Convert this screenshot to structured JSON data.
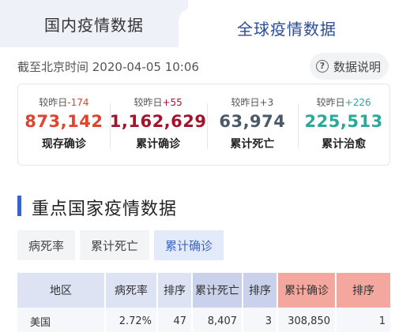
{
  "tabs": {
    "domestic": "国内疫情数据",
    "global": "全球疫情数据"
  },
  "info": {
    "timestamp": "截至北京时间 2020-04-05 10:06",
    "help_label": "数据说明",
    "help_icon": "?"
  },
  "summary": {
    "delta_prefix": "较昨日",
    "stats": [
      {
        "delta": "-174",
        "value": "873,142",
        "label": "现存确诊",
        "color": "#e0442d"
      },
      {
        "delta": "+55",
        "value": "1,162,629",
        "label": "累计确诊",
        "color": "#a3142a"
      },
      {
        "delta": "+3",
        "value": "63,974",
        "label": "累计死亡",
        "color": "#4b5a6b"
      },
      {
        "delta": "+226",
        "value": "225,513",
        "label": "累计治愈",
        "color": "#2aa898"
      }
    ]
  },
  "section": {
    "title": "重点国家疫情数据"
  },
  "subtabs": [
    "病死率",
    "累计死亡",
    "累计确诊"
  ],
  "table": {
    "headers": [
      "地区",
      "病死率",
      "排序",
      "累计死亡",
      "排序",
      "累计确诊",
      "排序"
    ],
    "rows": [
      [
        "美国",
        "2.72%",
        "47",
        "8,407",
        "3",
        "308,850",
        "1"
      ]
    ]
  },
  "colors": {
    "accent": "#3b63c4",
    "tab_active_text": "#2b4d94"
  }
}
